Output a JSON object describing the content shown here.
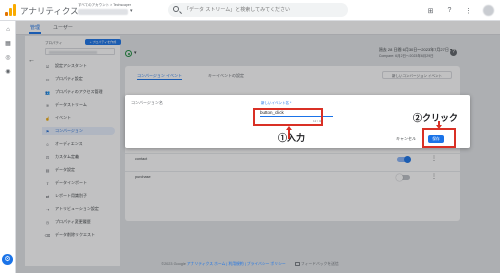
{
  "app": {
    "name": "アナリティクス"
  },
  "account": {
    "crumb": "すべてのアカウント > Techscaper"
  },
  "search": {
    "placeholder": "「データ ストリーム」と検索してみてください"
  },
  "admin_tabs": [
    {
      "label": "管理"
    },
    {
      "label": "ユーザー"
    }
  ],
  "admin_panel": {
    "property_label": "プロパティ",
    "create_property": "+ プロパティを作成",
    "nav": [
      {
        "label": "設定アシスタント",
        "icon": "check-list-icon"
      },
      {
        "label": "プロパティ設定",
        "icon": "settings-page-icon"
      },
      {
        "label": "プロパティのアクセス管理",
        "icon": "people-icon"
      },
      {
        "label": "データストリーム",
        "icon": "streams-icon"
      },
      {
        "label": "イベント",
        "icon": "touch-icon"
      },
      {
        "label": "コンバージョン",
        "icon": "flag-icon",
        "active": true
      },
      {
        "label": "オーディエンス",
        "icon": "audience-icon"
      },
      {
        "label": "カスタム定義",
        "icon": "custom-definitions-icon"
      },
      {
        "label": "データ設定",
        "icon": "database-icon"
      },
      {
        "label": "データインポート",
        "icon": "upload-icon"
      },
      {
        "label": "レポート用識別子",
        "icon": "reporting-id-icon"
      },
      {
        "label": "アトリビューション設定",
        "icon": "attribution-icon"
      },
      {
        "label": "プロパティ変更履歴",
        "icon": "history-icon"
      },
      {
        "label": "データ削除リクエスト",
        "icon": "delete-request-icon"
      }
    ]
  },
  "date": {
    "label": "過去 28 日間",
    "range": "6月30日〜2023年7月27日",
    "compare": "Compare: 6月2日〜2023年6月29日"
  },
  "card": {
    "tabs": [
      {
        "label": "コンバージョン イベント"
      },
      {
        "label": "キーイベントの設定"
      }
    ],
    "new_button": "新しいコンバージョン イベント",
    "rows": [
      {
        "name": "contact",
        "enabled": true
      },
      {
        "name": "purchase",
        "enabled": false
      }
    ]
  },
  "dialog": {
    "header": "コンバージョン名",
    "field_label": "新しいイベント名 *",
    "field_value": "button_click",
    "counter": "12 / 40",
    "cancel": "キャンセル",
    "save": "保存"
  },
  "annotations": {
    "input": "①入力",
    "click": "②クリック"
  },
  "footer": {
    "copyright": "©2023 Google",
    "links": "アナリティクス ホーム | 利用規約 | プライバシー ポリシー",
    "feedback": "フィードバックを送信"
  },
  "colors": {
    "accent": "#1a73e8",
    "annotation_red": "#d93025"
  }
}
